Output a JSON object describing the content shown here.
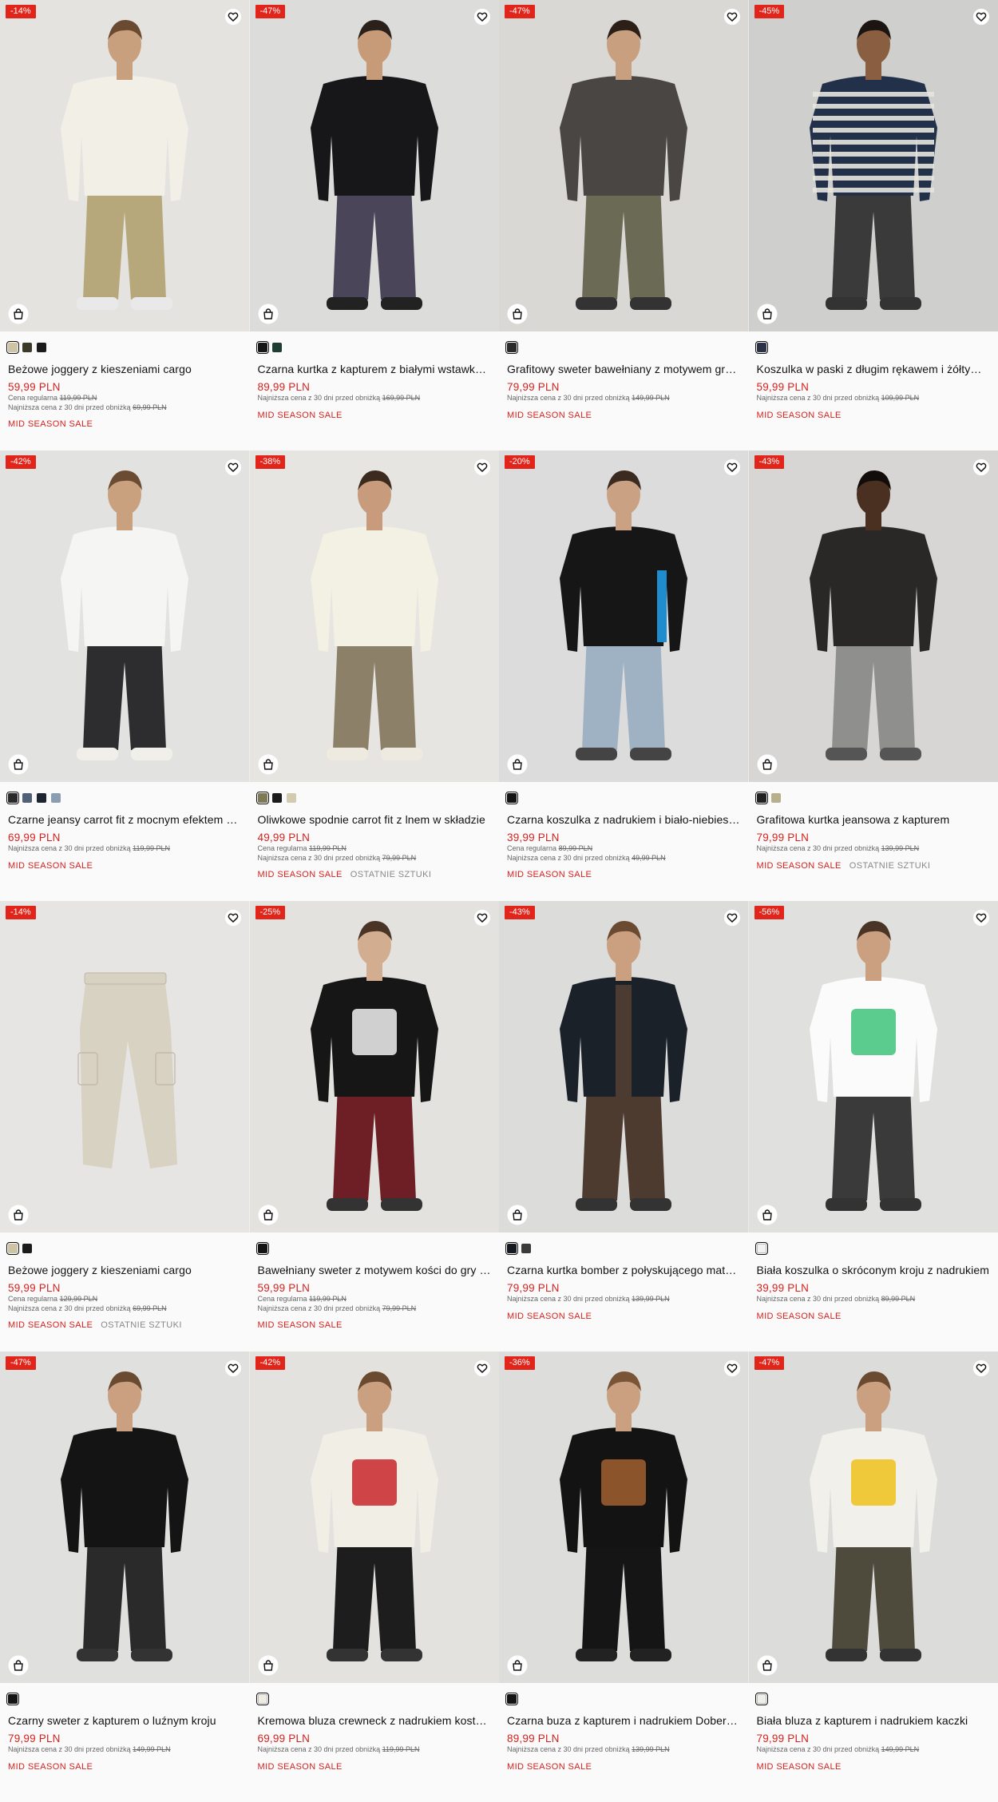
{
  "products": [
    {
      "discount": "-14%",
      "bg": "#e4e3e0",
      "colors": [
        "#cdc3a5",
        "#3b3a28",
        "#1b1b1b"
      ],
      "selected": 0,
      "figure": {
        "kind": "person",
        "top": "#f2efe6",
        "bottom": "#b7a87c",
        "skin": "#c9a07d",
        "hair": "#6a4a30",
        "shoes": "#e9e9e9"
      },
      "name": "Beżowe joggery z kieszeniami cargo",
      "price": "59,99 PLN",
      "meta": [
        {
          "label": "Cena regularna",
          "value": "119,99 PLN"
        },
        {
          "label": "Najniższa cena z 30 dni przed obniżką",
          "value": "69,99 PLN"
        }
      ],
      "sale": "MID SEASON SALE",
      "extra": ""
    },
    {
      "discount": "-47%",
      "bg": "#dcdcda",
      "colors": [
        "#161616",
        "#1f3d33"
      ],
      "selected": 0,
      "figure": {
        "kind": "person",
        "top": "#17171a",
        "bottom": "#4a4558",
        "skin": "#c79a78",
        "hair": "#2a211b",
        "shoes": "#222"
      },
      "name": "Czarna kurtka z kapturem z białymi wstawkami",
      "price": "89,99 PLN",
      "meta": [
        {
          "label": "Najniższa cena z 30 dni przed obniżką",
          "value": "169,99 PLN"
        }
      ],
      "sale": "MID SEASON SALE",
      "extra": ""
    },
    {
      "discount": "-47%",
      "bg": "#d9d8d5",
      "colors": [
        "#2d2b2a"
      ],
      "selected": 0,
      "figure": {
        "kind": "person",
        "top": "#4a4644",
        "bottom": "#6a6a55",
        "skin": "#c8a080",
        "hair": "#2b1f18",
        "shoes": "#333"
      },
      "name": "Grafitowy sweter bawełniany z motywem graficznym",
      "price": "79,99 PLN",
      "meta": [
        {
          "label": "Najniższa cena z 30 dni przed obniżką",
          "value": "149,99 PLN"
        }
      ],
      "sale": "MID SEASON SALE",
      "extra": ""
    },
    {
      "discount": "-45%",
      "bg": "#cfcfcd",
      "colors": [
        "#2b3245"
      ],
      "selected": 0,
      "figure": {
        "kind": "person",
        "top": "#23304a",
        "bottom": "#3a3a3a",
        "skin": "#8a5e40",
        "hair": "#1b1410",
        "shoes": "#333",
        "stripes": "#e7e5de"
      },
      "name": "Koszulka w paski z długim rękawem i żółtym haftem",
      "price": "59,99 PLN",
      "meta": [
        {
          "label": "Najniższa cena z 30 dni przed obniżką",
          "value": "109,99 PLN"
        }
      ],
      "sale": "MID SEASON SALE",
      "extra": ""
    },
    {
      "discount": "-42%",
      "bg": "#e2e2e0",
      "colors": [
        "#2a2a2c",
        "#4f6077",
        "#1f2433",
        "#8b9db0"
      ],
      "selected": 0,
      "figure": {
        "kind": "person",
        "top": "#f5f5f3",
        "bottom": "#2d2d2f",
        "skin": "#c9a17f",
        "hair": "#6b4b32",
        "shoes": "#f0efe9"
      },
      "name": "Czarne jeansy carrot fit z mocnym efektem sprania",
      "price": "69,99 PLN",
      "meta": [
        {
          "label": "Najniższa cena z 30 dni przed obniżką",
          "value": "119,99 PLN"
        }
      ],
      "sale": "MID SEASON SALE",
      "extra": ""
    },
    {
      "discount": "-38%",
      "bg": "#e6e5e2",
      "colors": [
        "#7d7a55",
        "#1b1b1b",
        "#d2cbb0"
      ],
      "selected": 0,
      "figure": {
        "kind": "person",
        "top": "#f3f0e4",
        "bottom": "#8c8068",
        "skin": "#c79b7b",
        "hair": "#3c2a1e",
        "shoes": "#eeeae0"
      },
      "name": "Oliwkowe spodnie carrot fit z lnem w składzie",
      "price": "49,99 PLN",
      "meta": [
        {
          "label": "Cena regularna",
          "value": "119,99 PLN"
        },
        {
          "label": "Najniższa cena z 30 dni przed obniżką",
          "value": "79,99 PLN"
        }
      ],
      "sale": "MID SEASON SALE",
      "extra": "OSTATNIE SZTUKI"
    },
    {
      "discount": "-20%",
      "bg": "#dcdcdc",
      "colors": [
        "#141414"
      ],
      "selected": 0,
      "figure": {
        "kind": "person",
        "top": "#161616",
        "bottom": "#9fb2c3",
        "skin": "#caa283",
        "hair": "#3a2a20",
        "shoes": "#444",
        "accent": "#1f8dcd"
      },
      "name": "Czarna koszulka z nadrukiem i biało-niebieskimi wstawkami",
      "price": "39,99 PLN",
      "meta": [
        {
          "label": "Cena regularna",
          "value": "89,99 PLN"
        },
        {
          "label": "Najniższa cena z 30 dni przed obniżką",
          "value": "49,99 PLN"
        }
      ],
      "sale": "MID SEASON SALE",
      "extra": ""
    },
    {
      "discount": "-43%",
      "bg": "#d7d6d4",
      "colors": [
        "#222222",
        "#b8b08a"
      ],
      "selected": 0,
      "figure": {
        "kind": "person",
        "top": "#2a2827",
        "bottom": "#8f8f8d",
        "skin": "#4a3020",
        "hair": "#120d0a",
        "shoes": "#555"
      },
      "name": "Grafitowa kurtka jeansowa z kapturem",
      "price": "79,99 PLN",
      "meta": [
        {
          "label": "Najniższa cena z 30 dni przed obniżką",
          "value": "139,99 PLN"
        }
      ],
      "sale": "MID SEASON SALE",
      "extra": "OSTATNIE SZTUKI"
    },
    {
      "discount": "-14%",
      "bg": "#e6e5e3",
      "colors": [
        "#cdc3a5",
        "#1b1b1b"
      ],
      "selected": 0,
      "figure": {
        "kind": "pants",
        "bottom": "#d8d2c2"
      },
      "name": "Beżowe joggery z kieszeniami cargo",
      "price": "59,99 PLN",
      "meta": [
        {
          "label": "Cena regularna",
          "value": "129,99 PLN"
        },
        {
          "label": "Najniższa cena z 30 dni przed obniżką",
          "value": "69,99 PLN"
        }
      ],
      "sale": "MID SEASON SALE",
      "extra": "OSTATNIE SZTUKI"
    },
    {
      "discount": "-25%",
      "bg": "#e3e2df",
      "colors": [
        "#141414"
      ],
      "selected": 0,
      "figure": {
        "kind": "person",
        "top": "#161616",
        "bottom": "#6d1f25",
        "skin": "#d3ad90",
        "hair": "#4a3426",
        "shoes": "#333",
        "print": "#f1f1f1"
      },
      "name": "Bawełniany sweter z motywem kości do gry i napisem",
      "price": "59,99 PLN",
      "meta": [
        {
          "label": "Cena regularna",
          "value": "119,99 PLN"
        },
        {
          "label": "Najniższa cena z 30 dni przed obniżką",
          "value": "79,99 PLN"
        }
      ],
      "sale": "MID SEASON SALE",
      "extra": ""
    },
    {
      "discount": "-43%",
      "bg": "#dcdcdb",
      "colors": [
        "#151a20",
        "#3a3a3a"
      ],
      "selected": 0,
      "figure": {
        "kind": "person",
        "top": "#1b2129",
        "bottom": "#4d3b30",
        "skin": "#caa080",
        "hair": "#6a4a30",
        "shoes": "#333",
        "inner": "#4b3b30"
      },
      "name": "Czarna kurtka bomber z połyskującego materiału",
      "price": "79,99 PLN",
      "meta": [
        {
          "label": "Najniższa cena z 30 dni przed obniżką",
          "value": "139,99 PLN"
        }
      ],
      "sale": "MID SEASON SALE",
      "extra": ""
    },
    {
      "discount": "-56%",
      "bg": "#e0e0de",
      "colors": [
        "#f2f2f2"
      ],
      "selected": 0,
      "figure": {
        "kind": "person",
        "top": "#fbfbfb",
        "bottom": "#3a3a3a",
        "skin": "#caa080",
        "hair": "#4a3426",
        "shoes": "#333",
        "print": "#3ec27a"
      },
      "name": "Biała koszulka o skróconym kroju z nadrukiem",
      "price": "39,99 PLN",
      "meta": [
        {
          "label": "Najniższa cena z 30 dni przed obniżką",
          "value": "89,99 PLN"
        }
      ],
      "sale": "MID SEASON SALE",
      "extra": ""
    },
    {
      "discount": "-47%",
      "bg": "#e0e0de",
      "colors": [
        "#141414"
      ],
      "selected": 0,
      "figure": {
        "kind": "person",
        "top": "#151414",
        "bottom": "#2a2a2a",
        "skin": "#caa080",
        "hair": "#6a4a30",
        "shoes": "#333"
      },
      "name": "Czarny sweter z kapturem o luźnym kroju",
      "price": "79,99 PLN",
      "meta": [
        {
          "label": "Najniższa cena z 30 dni przed obniżką",
          "value": "149,99 PLN"
        }
      ],
      "sale": "MID SEASON SALE",
      "extra": ""
    },
    {
      "discount": "-42%",
      "bg": "#e3e2df",
      "colors": [
        "#efece3"
      ],
      "selected": 0,
      "figure": {
        "kind": "person",
        "top": "#f1eee6",
        "bottom": "#1d1d1d",
        "skin": "#caa080",
        "hair": "#6a4a30",
        "shoes": "#333",
        "print": "#c9262a"
      },
      "name": "Kremowa bluza crewneck z nadrukiem kostek do gry",
      "price": "69,99 PLN",
      "meta": [
        {
          "label": "Najniższa cena z 30 dni przed obniżką",
          "value": "119,99 PLN"
        }
      ],
      "sale": "MID SEASON SALE",
      "extra": ""
    },
    {
      "discount": "-36%",
      "bg": "#dddddb",
      "colors": [
        "#141414"
      ],
      "selected": 0,
      "figure": {
        "kind": "person",
        "top": "#141313",
        "bottom": "#151515",
        "skin": "#caa080",
        "hair": "#7a5436",
        "shoes": "#222",
        "print": "#a1602f"
      },
      "name": "Czarna buza z kapturem i nadrukiem Dobermanów",
      "price": "89,99 PLN",
      "meta": [
        {
          "label": "Najniższa cena z 30 dni przed obniżką",
          "value": "139,99 PLN"
        }
      ],
      "sale": "MID SEASON SALE",
      "extra": ""
    },
    {
      "discount": "-47%",
      "bg": "#dcdcda",
      "colors": [
        "#f0eee8"
      ],
      "selected": 0,
      "figure": {
        "kind": "person",
        "top": "#f2f0ea",
        "bottom": "#4e4a3c",
        "skin": "#caa080",
        "hair": "#6a4a30",
        "shoes": "#333",
        "print": "#f0c21b"
      },
      "name": "Biała bluza z kapturem i nadrukiem kaczki",
      "price": "79,99 PLN",
      "meta": [
        {
          "label": "Najniższa cena z 30 dni przed obniżką",
          "value": "149,99 PLN"
        }
      ],
      "sale": "MID SEASON SALE",
      "extra": ""
    }
  ]
}
